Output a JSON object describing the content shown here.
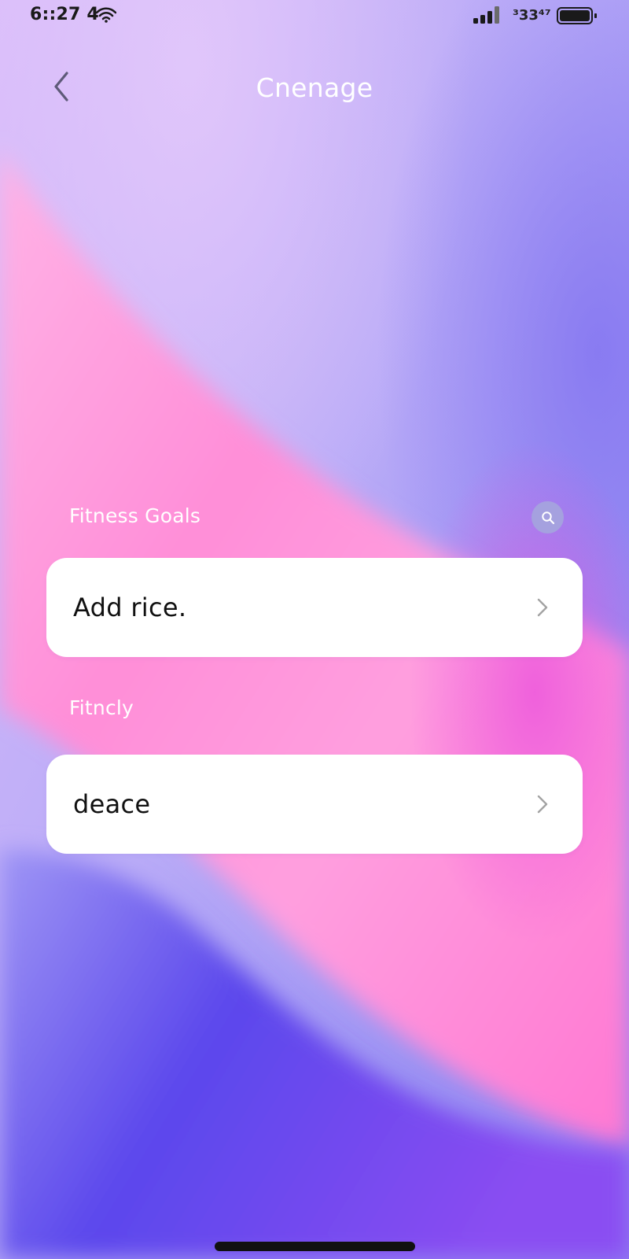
{
  "status_bar": {
    "time": "6::27 4",
    "extra": "³33⁴⁷"
  },
  "header": {
    "title": "Cnenage"
  },
  "sections": [
    {
      "label": "Fitness Goals",
      "card_text": "Add rice."
    },
    {
      "label": "Fitncly",
      "card_text": "deace"
    }
  ],
  "icons": {
    "back": "chevron-left-icon",
    "search": "search-icon",
    "row_chevron": "chevron-right-icon",
    "wifi": "wifi-icon",
    "signal": "signal-icon",
    "battery": "battery-icon"
  },
  "colors": {
    "background_lavender": "#c9b3f6",
    "wave_pink": "#ff86d6",
    "wave_violet": "#6a4cf0",
    "card": "#ffffff",
    "text_light": "#ffffff",
    "text_dark": "#111111"
  }
}
